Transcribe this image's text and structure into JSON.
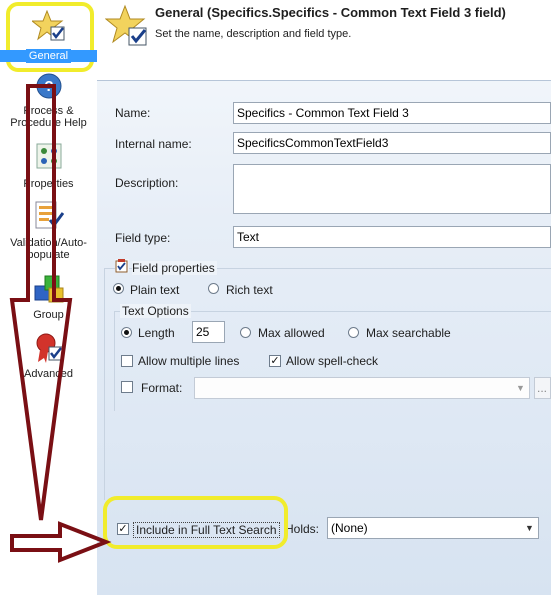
{
  "nav": {
    "items": [
      {
        "id": "general",
        "label": "General"
      },
      {
        "id": "process",
        "label": "Process & Procedure Help"
      },
      {
        "id": "properties",
        "label": "Properties"
      },
      {
        "id": "validation",
        "label": "Validation/Auto-populate"
      },
      {
        "id": "group",
        "label": "Group"
      },
      {
        "id": "advanced",
        "label": "Advanced"
      }
    ]
  },
  "header": {
    "title": "General (Specifics.Specifics - Common Text Field 3 field)",
    "subtitle": "Set the name, description and field type."
  },
  "form": {
    "name_label": "Name:",
    "name_value": "Specifics - Common Text Field 3",
    "internal_label": "Internal name:",
    "internal_value": "SpecificsCommonTextField3",
    "description_label": "Description:",
    "description_value": "",
    "field_type_label": "Field type:",
    "field_type_value": "Text"
  },
  "field_properties": {
    "title": "Field properties",
    "plain_text": "Plain text",
    "rich_text": "Rich text",
    "text_options_title": "Text Options",
    "length_label": "Length",
    "length_value": "25",
    "max_allowed": "Max allowed",
    "max_searchable": "Max searchable",
    "allow_multiple_lines": "Allow multiple lines",
    "allow_spell_check": "Allow spell-check",
    "format_label": "Format:",
    "format_value": "",
    "format_button": "..."
  },
  "footer": {
    "full_text_label": "Include in Full Text Search",
    "holds_label": "Holds:",
    "holds_value": "(None)"
  },
  "colors": {
    "accent": "#3399ff",
    "highlight": "#f1ec2c",
    "arrow": "#7a0f14"
  }
}
